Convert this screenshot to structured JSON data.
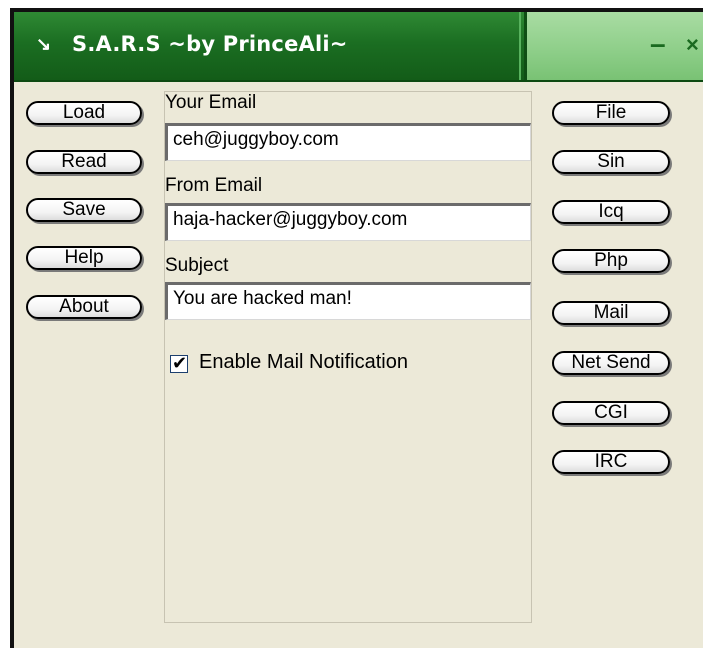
{
  "window": {
    "title": "S.A.R.S ~by PrinceAli~",
    "app_icon": "↘",
    "minimize_label": "–",
    "close_label": "×"
  },
  "left_buttons": [
    "Load",
    "Read",
    "Save",
    "Help",
    "About"
  ],
  "right_buttons": [
    "File",
    "Sin",
    "Icq",
    "Php",
    "Mail",
    "Net Send",
    "CGI",
    "IRC"
  ],
  "form": {
    "your_email_label": "Your Email",
    "your_email_value": "ceh@juggyboy.com",
    "from_email_label": "From Email",
    "from_email_value": "haja-hacker@juggyboy.com",
    "subject_label": "Subject",
    "subject_value": "You are hacked man!",
    "notification_label": "Enable Mail Notification",
    "notification_checked": true,
    "check_mark": "✔"
  },
  "colors": {
    "titlebar_green": "#1b6e22",
    "titlebar_light_green": "#8fcf8a",
    "window_bg": "#ece9d8"
  },
  "icons": {
    "app": "arrow-icon",
    "minimize": "minimize-icon",
    "close": "close-icon"
  }
}
